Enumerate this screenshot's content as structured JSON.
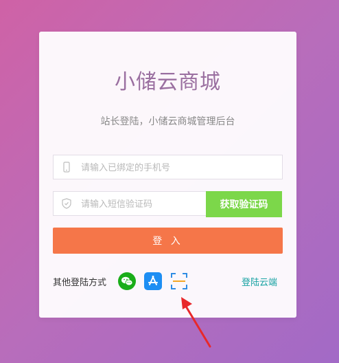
{
  "title": "小储云商城",
  "subtitle": "站长登陆，小储云商城管理后台",
  "form": {
    "phone_placeholder": "请输入已绑定的手机号",
    "code_placeholder": "请输入短信验证码",
    "get_code_label": "获取验证码",
    "login_label": "登 入"
  },
  "other_login": {
    "label": "其他登陆方式",
    "icons": [
      "wechat-icon",
      "app-store-icon",
      "scan-icon"
    ]
  },
  "cloud_link": "登陆云端",
  "colors": {
    "accent_orange": "#f57649",
    "accent_green": "#7cd74a",
    "link_teal": "#17a2a2",
    "annotation_red": "#e8282b"
  }
}
